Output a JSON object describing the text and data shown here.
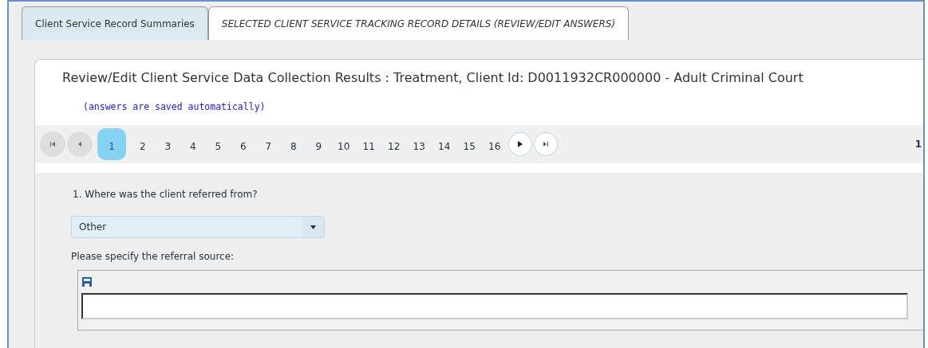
{
  "tabs": [
    {
      "label": "Client Service Record Summaries",
      "selected": false
    },
    {
      "label": "SELECTED CLIENT SERVICE TRACKING RECORD DETAILS (REVIEW/EDIT ANSWERS)",
      "selected": true
    }
  ],
  "panel": {
    "title": "Review/Edit Client Service Data Collection Results : Treatment, Client Id: D0011932CR000000 - Adult Criminal Court",
    "note": "(answers are saved automatically)"
  },
  "pager": {
    "pages": [
      {
        "label": "1",
        "selected": true
      },
      {
        "label": "2",
        "selected": false
      },
      {
        "label": "3",
        "selected": false
      },
      {
        "label": "4",
        "selected": false
      },
      {
        "label": "5",
        "selected": false
      },
      {
        "label": "6",
        "selected": false
      },
      {
        "label": "7",
        "selected": false
      },
      {
        "label": "8",
        "selected": false
      },
      {
        "label": "9",
        "selected": false
      },
      {
        "label": "10",
        "selected": false
      },
      {
        "label": "11",
        "selected": false
      },
      {
        "label": "12",
        "selected": false
      },
      {
        "label": "13",
        "selected": false
      },
      {
        "label": "14",
        "selected": false
      },
      {
        "label": "15",
        "selected": false
      },
      {
        "label": "16",
        "selected": false
      }
    ],
    "info": "1"
  },
  "question": {
    "label": "1. Where was the client referred from?",
    "answer": "Other",
    "followup_label": "Please specify the referral source:"
  }
}
